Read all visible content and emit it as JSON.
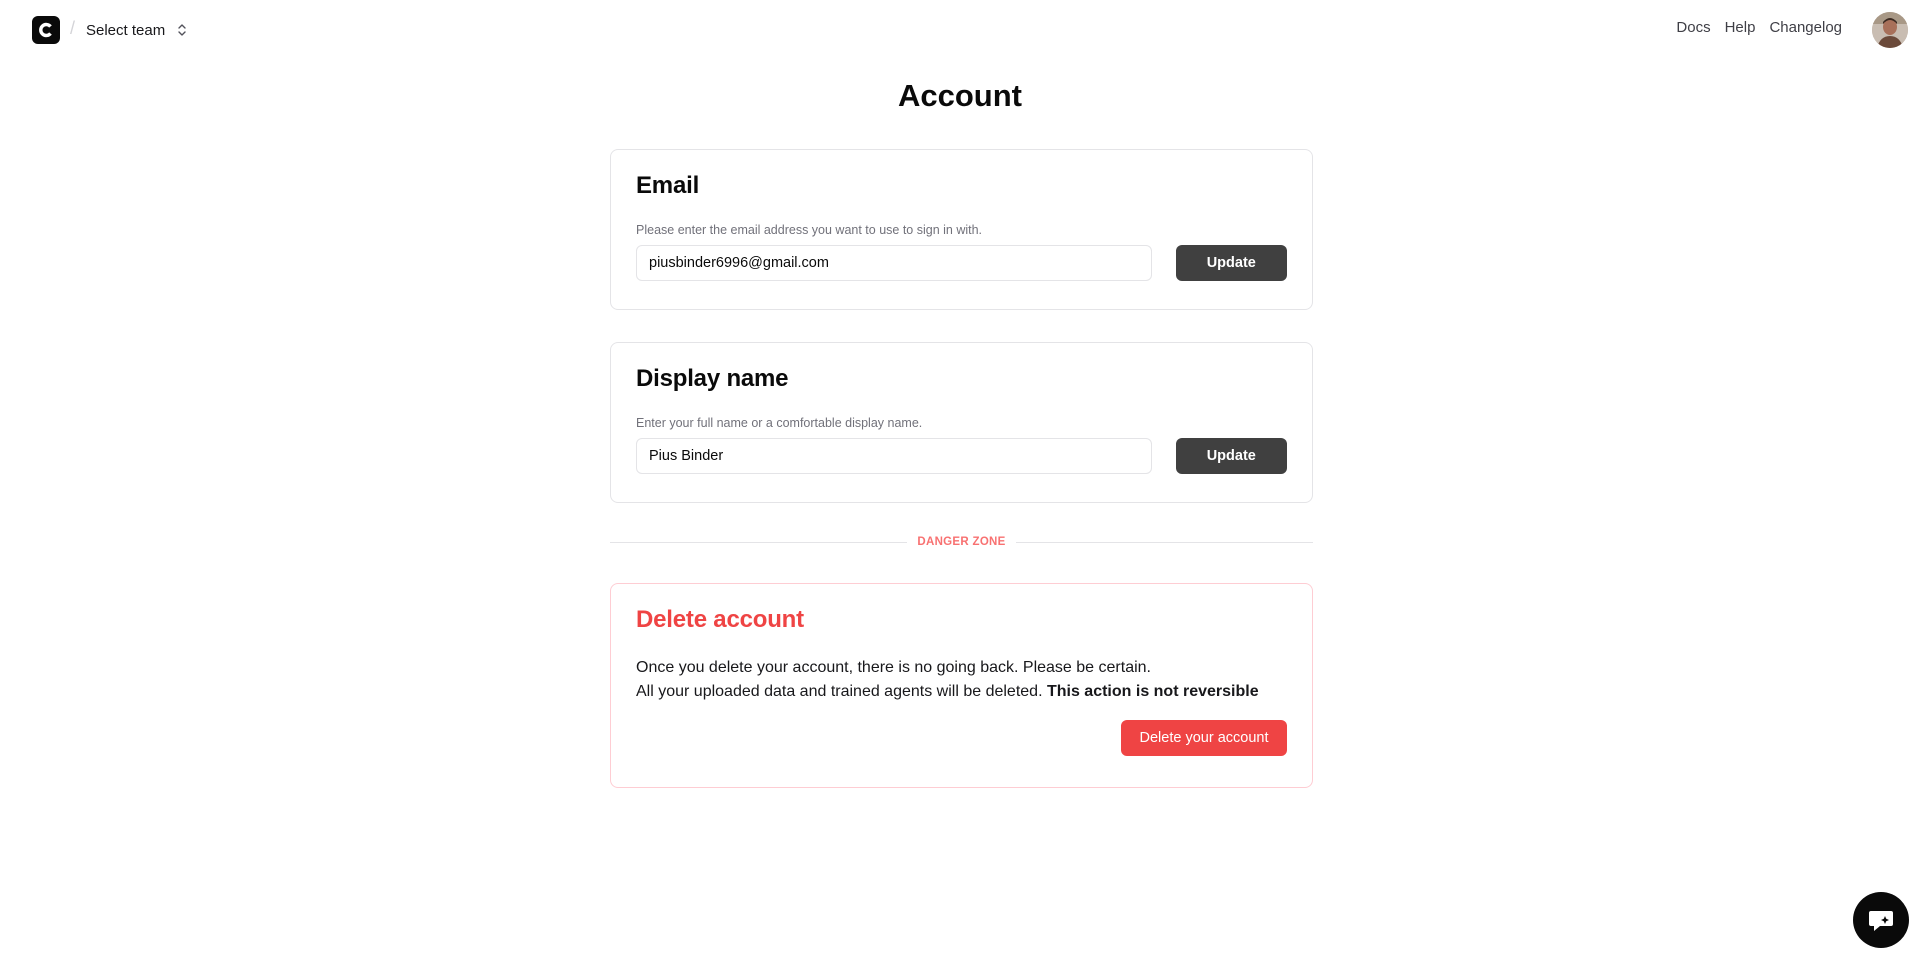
{
  "header": {
    "team_select_label": "Select team",
    "separator": "/",
    "nav": [
      "Docs",
      "Help",
      "Changelog"
    ]
  },
  "page": {
    "title": "Account"
  },
  "email_card": {
    "title": "Email",
    "description": "Please enter the email address you want to use to sign in with.",
    "value": "piusbinder6996@gmail.com",
    "button": "Update"
  },
  "name_card": {
    "title": "Display name",
    "description": "Enter your full name or a comfortable display name.",
    "value": "Pius Binder",
    "button": "Update"
  },
  "danger": {
    "divider_label": "DANGER ZONE",
    "title": "Delete account",
    "line1": "Once you delete your account, there is no going back. Please be certain.",
    "line2": "All your uploaded data and trained agents will be deleted.",
    "line2_bold": "This action is not reversible",
    "button": "Delete your account"
  },
  "colors": {
    "danger": "#ef4444",
    "button_dark": "#404040",
    "border": "#e4e4e7"
  },
  "icons": {
    "logo": "logo-icon",
    "team_select": "chevron-up-down-icon",
    "chat": "chat-icon"
  }
}
